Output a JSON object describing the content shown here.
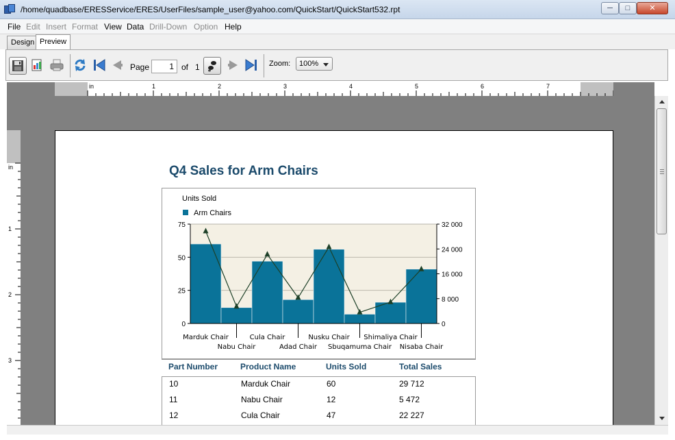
{
  "window": {
    "title": "/home/quadbase/ERESService/ERES/UserFiles/sample_user@yahoo.com/QuickStart/QuickStart532.rpt",
    "controls": {
      "minimize": "─",
      "maximize": "□",
      "close": "✕"
    }
  },
  "menu": {
    "items": [
      {
        "label": "File",
        "enabled": true
      },
      {
        "label": "Edit",
        "enabled": false
      },
      {
        "label": "Insert",
        "enabled": false
      },
      {
        "label": "Format",
        "enabled": false
      },
      {
        "label": "View",
        "enabled": true
      },
      {
        "label": "Data",
        "enabled": true
      },
      {
        "label": "Drill-Down",
        "enabled": false
      },
      {
        "label": "Option",
        "enabled": false
      },
      {
        "label": "Help",
        "enabled": true
      }
    ]
  },
  "tabs": [
    {
      "label": "Design",
      "active": false
    },
    {
      "label": "Preview",
      "active": true
    }
  ],
  "toolbar": {
    "icons": [
      "save-icon",
      "export-icon",
      "print-icon",
      "refresh-icon",
      "first-page-icon",
      "previous-page-icon",
      "go-to-page-icon",
      "next-page-icon",
      "last-page-icon"
    ],
    "page_label": "Page",
    "page_value": "1",
    "of_label": "of",
    "total_pages": "1",
    "zoom_label": "Zoom:",
    "zoom_value": "100%"
  },
  "ruler": {
    "unit": "in",
    "h_labels": [
      "1",
      "2",
      "3",
      "4",
      "5",
      "6",
      "7"
    ],
    "v_labels": [
      "1",
      "2",
      "3"
    ]
  },
  "report": {
    "title": "Q4 Sales for Arm Chairs",
    "columns": [
      "Part Number",
      "Product Name",
      "Units Sold",
      "Total Sales"
    ],
    "rows": [
      [
        "10",
        "Marduk Chair",
        "60",
        "29 712"
      ],
      [
        "11",
        "Nabu Chair",
        "12",
        "5 472"
      ],
      [
        "12",
        "Cula Chair",
        "47",
        "22 227"
      ]
    ]
  },
  "chart_data": {
    "type": "bar",
    "title": "",
    "ylabel": "Units Sold",
    "legend": {
      "entries": [
        "Arm Chairs"
      ],
      "placement": "top-left"
    },
    "categories": [
      "Marduk Chair",
      "Nabu Chair",
      "Cula Chair",
      "Adad Chair",
      "Nusku Chair",
      "Sbuqamuma Chair",
      "Shimaliya Chair",
      "Nisaba Chair"
    ],
    "series": [
      {
        "name": "Arm Chairs",
        "type": "bar",
        "axis": "left",
        "values": [
          60,
          12,
          47,
          18,
          56,
          7,
          16,
          41
        ]
      },
      {
        "type": "line",
        "axis": "right",
        "values": [
          29712,
          5472,
          22227,
          8300,
          24600,
          3600,
          6900,
          17500
        ]
      }
    ],
    "ylim": [
      0,
      75
    ],
    "yticks": [
      "0",
      "25",
      "50",
      "75"
    ],
    "y2lim": [
      0,
      32000
    ],
    "y2ticks": [
      "0",
      "8 000",
      "16 000",
      "24 000",
      "32 000"
    ],
    "grid": true,
    "colors": {
      "bar": "#0a7399",
      "line": "#1d4028",
      "plot_bg": "#f4f0e4",
      "grid": "#b4b0a4"
    }
  }
}
